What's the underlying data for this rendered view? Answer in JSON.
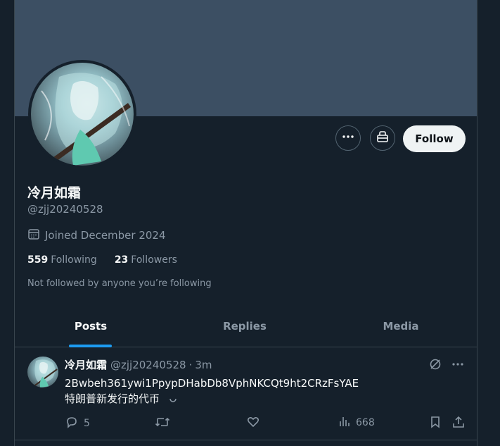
{
  "profile": {
    "name": "冷月如霜",
    "handle": "@zjj20240528",
    "joined": "Joined December 2024",
    "following_count": "559",
    "following_label": "Following",
    "followers_count": "23",
    "followers_label": "Followers",
    "followed_by_note": "Not followed by anyone you’re following",
    "follow_button": "Follow"
  },
  "tabs": [
    {
      "label": "Posts",
      "active": true
    },
    {
      "label": "Replies",
      "active": false
    },
    {
      "label": "Media",
      "active": false
    }
  ],
  "post": {
    "name": "冷月如霜",
    "handle": "@zjj20240528",
    "separator": "·",
    "time": "3m",
    "line1": "2Bwbeh361ywi1PpypDHabDb8VphNKCQt9ht2CRzFsYAE",
    "line2": "特朗普新发行的代币",
    "replies": "5",
    "views": "668"
  },
  "colors": {
    "background": "#15202b",
    "banner": "#3c4f63",
    "accent": "#1d9bf0",
    "muted_text": "#8b98a5",
    "border": "#38444d"
  },
  "icons": [
    "more-icon",
    "gift-icon",
    "calendar-icon",
    "grok-icon",
    "reply-icon",
    "repost-icon",
    "like-icon",
    "views-icon",
    "bookmark-icon",
    "share-icon"
  ]
}
